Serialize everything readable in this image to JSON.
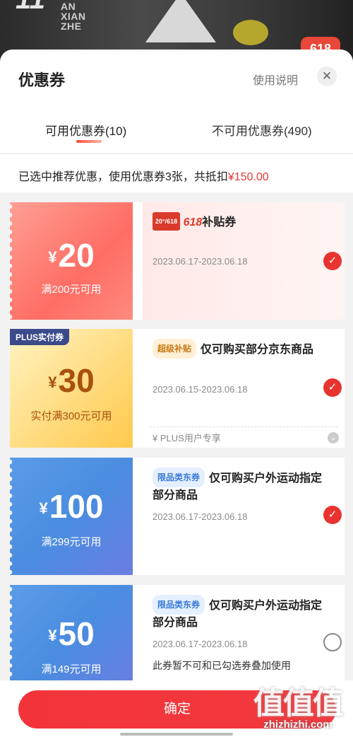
{
  "background": {
    "logo_mark": "11",
    "logo_text": "AN XIAN ZHE",
    "sale_badge": "618"
  },
  "sheet": {
    "title": "优惠券",
    "help_label": "使用说明",
    "close_icon": "close-icon"
  },
  "tabs": [
    {
      "label": "可用优惠券(10)",
      "active": true
    },
    {
      "label": "不可用优惠券(490)",
      "active": false
    }
  ],
  "summary": {
    "text": "已选中推荐优惠，使用优惠券3张，共抵扣",
    "amount": "¥150.00"
  },
  "coupons": [
    {
      "currency": "¥",
      "value": "20",
      "condition": "满200元可用",
      "badge_small": "20°/618",
      "badge_618": "618",
      "title": "补贴券",
      "date": "2023.06.17-2023.06.18",
      "checked": true
    },
    {
      "corner_badge": "PLUS实付券",
      "currency": "¥",
      "value": "30",
      "condition": "实付满300元可用",
      "tag": "超级补贴",
      "title": "仅可购买部分京东商品",
      "date": "2023.06.15-2023.06.18",
      "checked": true,
      "footer": "PLUS用户专享"
    },
    {
      "currency": "¥",
      "value": "100",
      "condition": "满299元可用",
      "tag": "限品类东券",
      "title": "仅可购买户外运动指定部分商品",
      "date": "2023.06.17-2023.06.18",
      "checked": true
    },
    {
      "currency": "¥",
      "value": "50",
      "condition": "满149元可用",
      "tag": "限品类东券",
      "title": "仅可购买户外运动指定部分商品",
      "date": "2023.06.17-2023.06.18",
      "checked": false,
      "note": "此券暂不可和已勾选券叠加使用"
    }
  ],
  "confirm_label": "确定",
  "watermark": {
    "chars": "值值值",
    "url": "zhizhizhi.com"
  },
  "colors": {
    "accent": "#e8332f",
    "price_red": "#e53935",
    "blue_card": "#4a8de0",
    "gold_card": "#ffd97a",
    "pink_card": "#ff6d63"
  }
}
